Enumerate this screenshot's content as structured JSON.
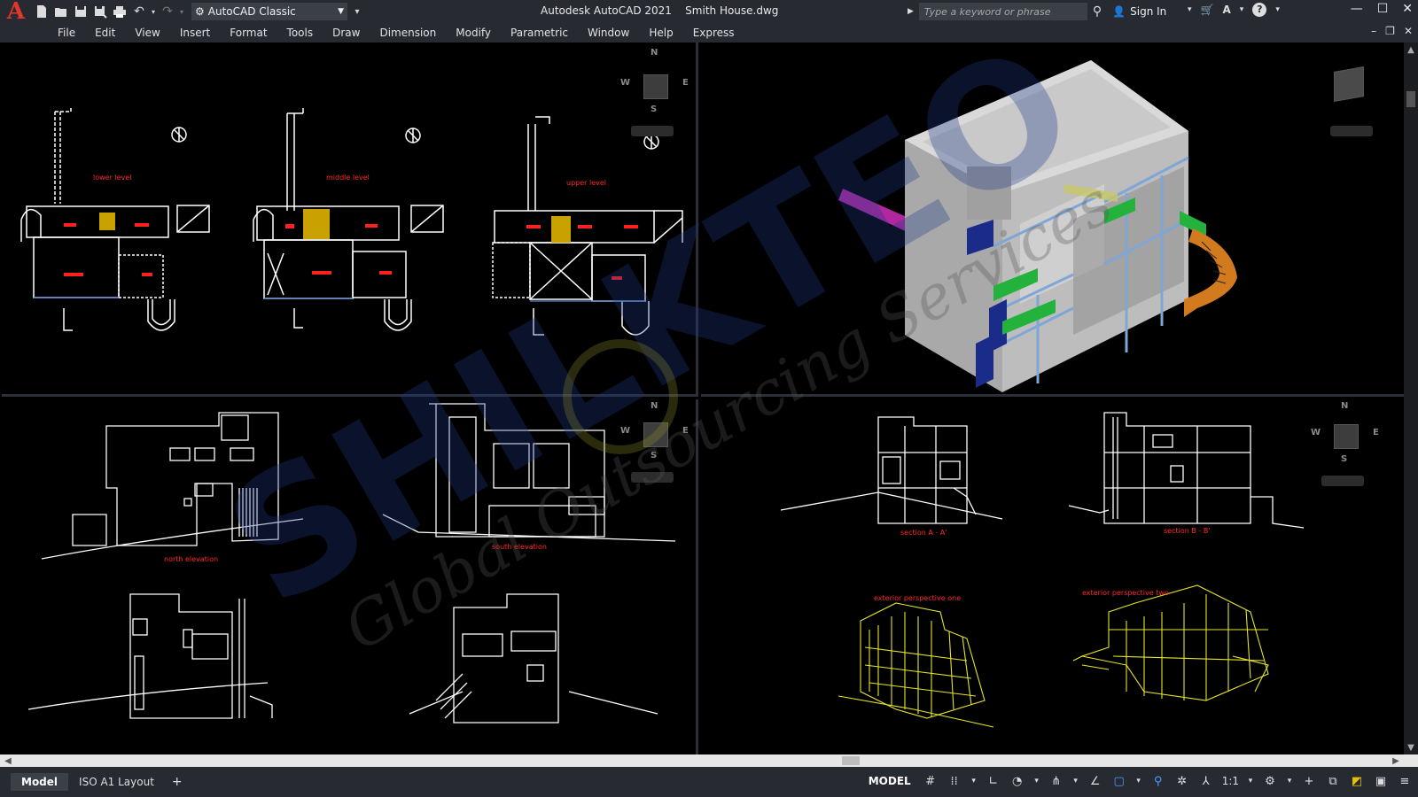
{
  "title_bar": {
    "app_logo": "A",
    "workspace": "AutoCAD Classic",
    "document_title": "Autodesk AutoCAD 2021    Smith House.dwg",
    "search_placeholder": "Type a keyword or phrase",
    "sign_in": "Sign In"
  },
  "menu": {
    "items": [
      "File",
      "Edit",
      "View",
      "Insert",
      "Format",
      "Tools",
      "Draw",
      "Dimension",
      "Modify",
      "Parametric",
      "Window",
      "Help",
      "Express"
    ]
  },
  "viewports": {
    "top_left": {
      "labels": [
        "lower level",
        "middle level",
        "upper level"
      ],
      "compass": {
        "n": "N",
        "s": "S",
        "e": "E",
        "w": "W"
      }
    },
    "bottom_left": {
      "labels": [
        "north elevation",
        "south elevation"
      ],
      "compass": {
        "n": "N",
        "s": "S",
        "e": "E",
        "w": "W"
      }
    },
    "bottom_right": {
      "labels": [
        "section A - A'",
        "section B - B'",
        "exterior perspective one",
        "exterior perspective two"
      ],
      "compass": {
        "n": "N",
        "s": "S",
        "e": "E",
        "w": "W"
      }
    }
  },
  "watermark": {
    "brand": "SHILKTEO",
    "tagline": "Global Outsourcing Services"
  },
  "status_bar": {
    "tabs": [
      "Model",
      "ISO A1 Layout"
    ],
    "add_tab": "+",
    "model_label": "MODEL",
    "scale": "1:1"
  },
  "colors": {
    "chrome": "#272a31",
    "logo_red": "#e0382f",
    "label_red": "#ff2a2a",
    "linework": "#ffffff",
    "perspective_yellow": "#e6e62a"
  }
}
